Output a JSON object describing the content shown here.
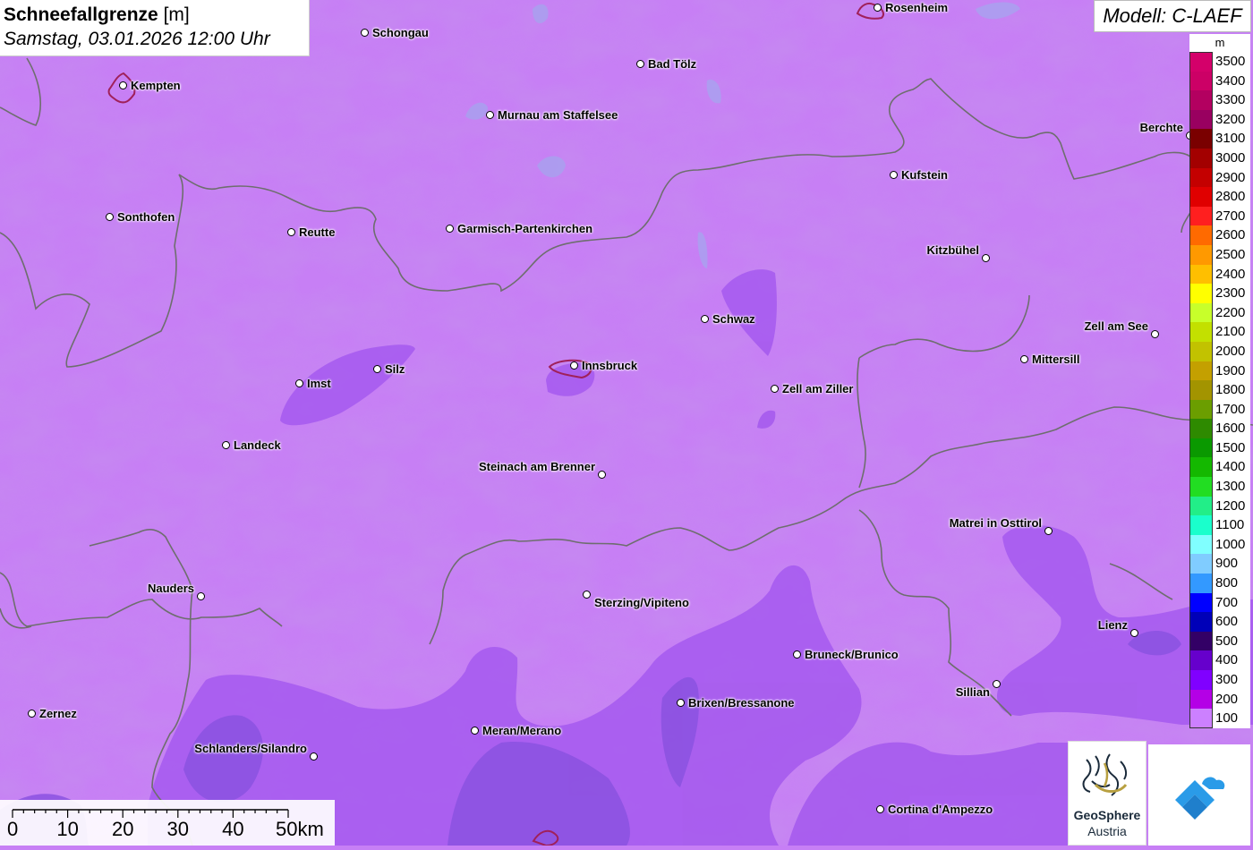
{
  "title": {
    "label": "Schneefallgrenze",
    "unit": "[m]",
    "datetime": "Samstag, 03.01.2026 12:00 Uhr"
  },
  "model": "Modell: C-LAEF",
  "legend": {
    "unit": "m",
    "entries": [
      {
        "value": "3500",
        "color": "#d4006a"
      },
      {
        "value": "3400",
        "color": "#cc0066"
      },
      {
        "value": "3300",
        "color": "#b30060"
      },
      {
        "value": "3200",
        "color": "#990060"
      },
      {
        "value": "3100",
        "color": "#7a0000"
      },
      {
        "value": "3000",
        "color": "#a30000"
      },
      {
        "value": "2900",
        "color": "#c40000"
      },
      {
        "value": "2800",
        "color": "#e00000"
      },
      {
        "value": "2700",
        "color": "#ff1f1f"
      },
      {
        "value": "2600",
        "color": "#ff6a00"
      },
      {
        "value": "2500",
        "color": "#ff9900"
      },
      {
        "value": "2400",
        "color": "#ffbf00"
      },
      {
        "value": "2300",
        "color": "#ffff00"
      },
      {
        "value": "2200",
        "color": "#c8ff2a"
      },
      {
        "value": "2100",
        "color": "#c3e000"
      },
      {
        "value": "2000",
        "color": "#c2c200"
      },
      {
        "value": "1900",
        "color": "#c4a000"
      },
      {
        "value": "1800",
        "color": "#a39400"
      },
      {
        "value": "1700",
        "color": "#6b9e00"
      },
      {
        "value": "1600",
        "color": "#2e8a00"
      },
      {
        "value": "1500",
        "color": "#0a9900"
      },
      {
        "value": "1400",
        "color": "#14b800"
      },
      {
        "value": "1300",
        "color": "#22dd22"
      },
      {
        "value": "1200",
        "color": "#22ee88"
      },
      {
        "value": "1100",
        "color": "#1affcc"
      },
      {
        "value": "1000",
        "color": "#80ffff"
      },
      {
        "value": "900",
        "color": "#80ccff"
      },
      {
        "value": "800",
        "color": "#3399ff"
      },
      {
        "value": "700",
        "color": "#0000ff"
      },
      {
        "value": "600",
        "color": "#0000b8"
      },
      {
        "value": "500",
        "color": "#330066"
      },
      {
        "value": "400",
        "color": "#6600cc"
      },
      {
        "value": "300",
        "color": "#8000ff"
      },
      {
        "value": "200",
        "color": "#b400e6"
      },
      {
        "value": "100",
        "color": "#cc80ff"
      }
    ]
  },
  "cities": [
    {
      "name": "Rosenheim",
      "id": "rosenheim"
    },
    {
      "name": "Schongau",
      "id": "schongau"
    },
    {
      "name": "Kempten",
      "id": "kempten"
    },
    {
      "name": "Bad Tölz",
      "id": "bad-toelz"
    },
    {
      "name": "Murnau am Staffelsee",
      "id": "murnau"
    },
    {
      "name": "Berchte",
      "id": "berchtesgaden"
    },
    {
      "name": "Kufstein",
      "id": "kufstein"
    },
    {
      "name": "Sonthofen",
      "id": "sonthofen"
    },
    {
      "name": "Reutte",
      "id": "reutte"
    },
    {
      "name": "Garmisch-Partenkirchen",
      "id": "garmisch"
    },
    {
      "name": "Kitzbühel",
      "id": "kitzbuehel"
    },
    {
      "name": "Schwaz",
      "id": "schwaz"
    },
    {
      "name": "Zell am See",
      "id": "zell-am-see"
    },
    {
      "name": "Mittersill",
      "id": "mittersill"
    },
    {
      "name": "Imst",
      "id": "imst"
    },
    {
      "name": "Silz",
      "id": "silz"
    },
    {
      "name": "Innsbruck",
      "id": "innsbruck"
    },
    {
      "name": "Zell am Ziller",
      "id": "zell-am-ziller"
    },
    {
      "name": "Landeck",
      "id": "landeck"
    },
    {
      "name": "Steinach am Brenner",
      "id": "steinach"
    },
    {
      "name": "Matrei in Osttirol",
      "id": "matrei"
    },
    {
      "name": "Nauders",
      "id": "nauders"
    },
    {
      "name": "Sterzing/Vipiteno",
      "id": "sterzing"
    },
    {
      "name": "Lienz",
      "id": "lienz"
    },
    {
      "name": "Bruneck/Brunico",
      "id": "bruneck"
    },
    {
      "name": "Sillian",
      "id": "sillian"
    },
    {
      "name": "Brixen/Bressanone",
      "id": "brixen"
    },
    {
      "name": "Zernez",
      "id": "zernez"
    },
    {
      "name": "Meran/Merano",
      "id": "meran"
    },
    {
      "name": "Schlanders/Silandro",
      "id": "schlanders"
    },
    {
      "name": "Cortina d'Ampezzo",
      "id": "cortina"
    }
  ],
  "scale": {
    "ticks": [
      "0",
      "10",
      "20",
      "30",
      "40",
      "50km"
    ]
  },
  "logos": {
    "geosphere_line1": "GeoSphere",
    "geosphere_line2": "Austria"
  },
  "colors": {
    "base_fill": "#c77ff5",
    "low_fill": "#a25ae8",
    "lower_fill": "#8d4ddc",
    "border": "#6e6e6e"
  }
}
